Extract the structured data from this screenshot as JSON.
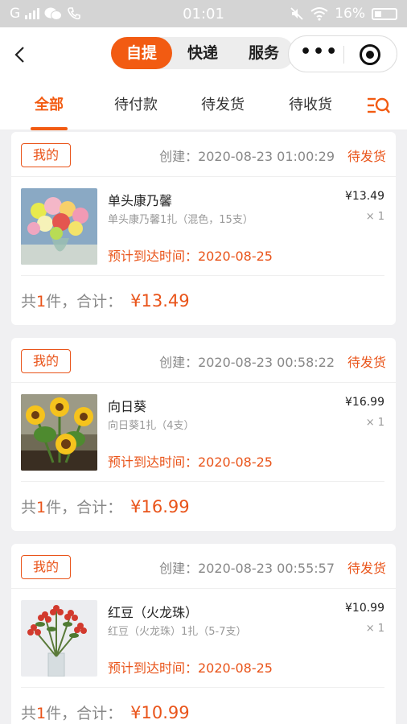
{
  "status_bar": {
    "carrier": "G",
    "time": "01:01",
    "battery": "16%"
  },
  "nav": {
    "segments": [
      {
        "label": "自提",
        "active": true
      },
      {
        "label": "快递",
        "active": false
      },
      {
        "label": "服务",
        "active": false
      }
    ],
    "more_label": "•••"
  },
  "tabs": [
    {
      "label": "全部",
      "active": true
    },
    {
      "label": "待付款",
      "active": false
    },
    {
      "label": "待发货",
      "active": false
    },
    {
      "label": "待收货",
      "active": false
    }
  ],
  "orders": [
    {
      "tag": "我的",
      "created": "创建：2020-08-23 01:00:29",
      "status": "待发货",
      "product_name": "单头康乃馨",
      "spec": "单头康乃馨1扎（混色，15支）",
      "eta": "预计到达时间：2020-08-25",
      "price": "¥13.49",
      "qty": "× 1",
      "total_prefix": "共",
      "total_count": "1",
      "total_mid": "件，合计：",
      "total_amount": "¥13.49"
    },
    {
      "tag": "我的",
      "created": "创建：2020-08-23 00:58:22",
      "status": "待发货",
      "product_name": "向日葵",
      "spec": "向日葵1扎（4支）",
      "eta": "预计到达时间：2020-08-25",
      "price": "¥16.99",
      "qty": "× 1",
      "total_prefix": "共",
      "total_count": "1",
      "total_mid": "件，合计：",
      "total_amount": "¥16.99"
    },
    {
      "tag": "我的",
      "created": "创建：2020-08-23 00:55:57",
      "status": "待发货",
      "product_name": "红豆（火龙珠）",
      "spec": "红豆（火龙珠）1扎（5-7支）",
      "eta": "预计到达时间：2020-08-25",
      "price": "¥10.99",
      "qty": "× 1",
      "total_prefix": "共",
      "total_count": "1",
      "total_mid": "件，合计：",
      "total_amount": "¥10.99"
    }
  ],
  "colors": {
    "accent": "#f25b12",
    "price": "#e9541a"
  }
}
